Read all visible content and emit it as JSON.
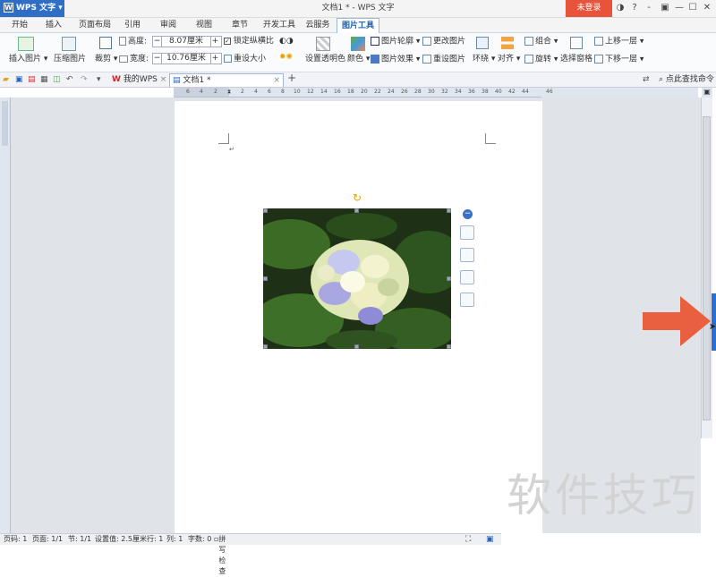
{
  "app": {
    "name": "WPS 文字",
    "window_title": "文档1 * - WPS 文字",
    "login": "未登录"
  },
  "window": {
    "controls": [
      "◑",
      "?",
      "-",
      "▣",
      "—",
      "☐",
      "✕"
    ]
  },
  "menu_tabs": [
    "开始",
    "插入",
    "页面布局",
    "引用",
    "审阅",
    "视图",
    "章节",
    "开发工具",
    "云服务",
    "图片工具"
  ],
  "active_tab": "图片工具",
  "ribbon": {
    "insert_picture": "插入图片",
    "compress": "压缩图片",
    "crop": "裁剪",
    "height_label": "高度:",
    "height_value": "8.07厘米",
    "width_label": "宽度:",
    "width_value": "10.76厘米",
    "lock_ratio": "锁定纵横比",
    "reset_size": "重设大小",
    "transparent": "设置透明色",
    "color": "颜色",
    "outline": "图片轮廓",
    "effect": "图片效果",
    "change": "更改图片",
    "reset": "重设图片",
    "wrap": "环绕",
    "align": "对齐",
    "group": "组合",
    "rotate": "旋转",
    "selection_pane": "选择窗格",
    "bring_forward": "上移一层",
    "send_backward": "下移一层"
  },
  "quick": {
    "my_wps": "我的WPS",
    "doc_tab": "文档1 *",
    "add": "+",
    "search": "点此查找命令"
  },
  "ruler": [
    "6",
    "4",
    "2",
    "",
    "2",
    "4",
    "6",
    "8",
    "10",
    "12",
    "14",
    "16",
    "18",
    "20",
    "22",
    "24",
    "26",
    "28",
    "30",
    "32",
    "34",
    "36",
    "38",
    "40",
    "42",
    "44",
    "46"
  ],
  "status": {
    "page": "页码: 1",
    "pages": "页面: 1/1",
    "section": "节: 1/1",
    "setting": "设置值: 2.5厘米",
    "row": "行: 1",
    "col": "列: 1",
    "words": "字数: 0",
    "spell": "拼写检查"
  },
  "watermark": "软件技巧",
  "colors": {
    "accent": "#2e6ec4",
    "login": "#e8533b",
    "arrow": "#e8603f"
  }
}
